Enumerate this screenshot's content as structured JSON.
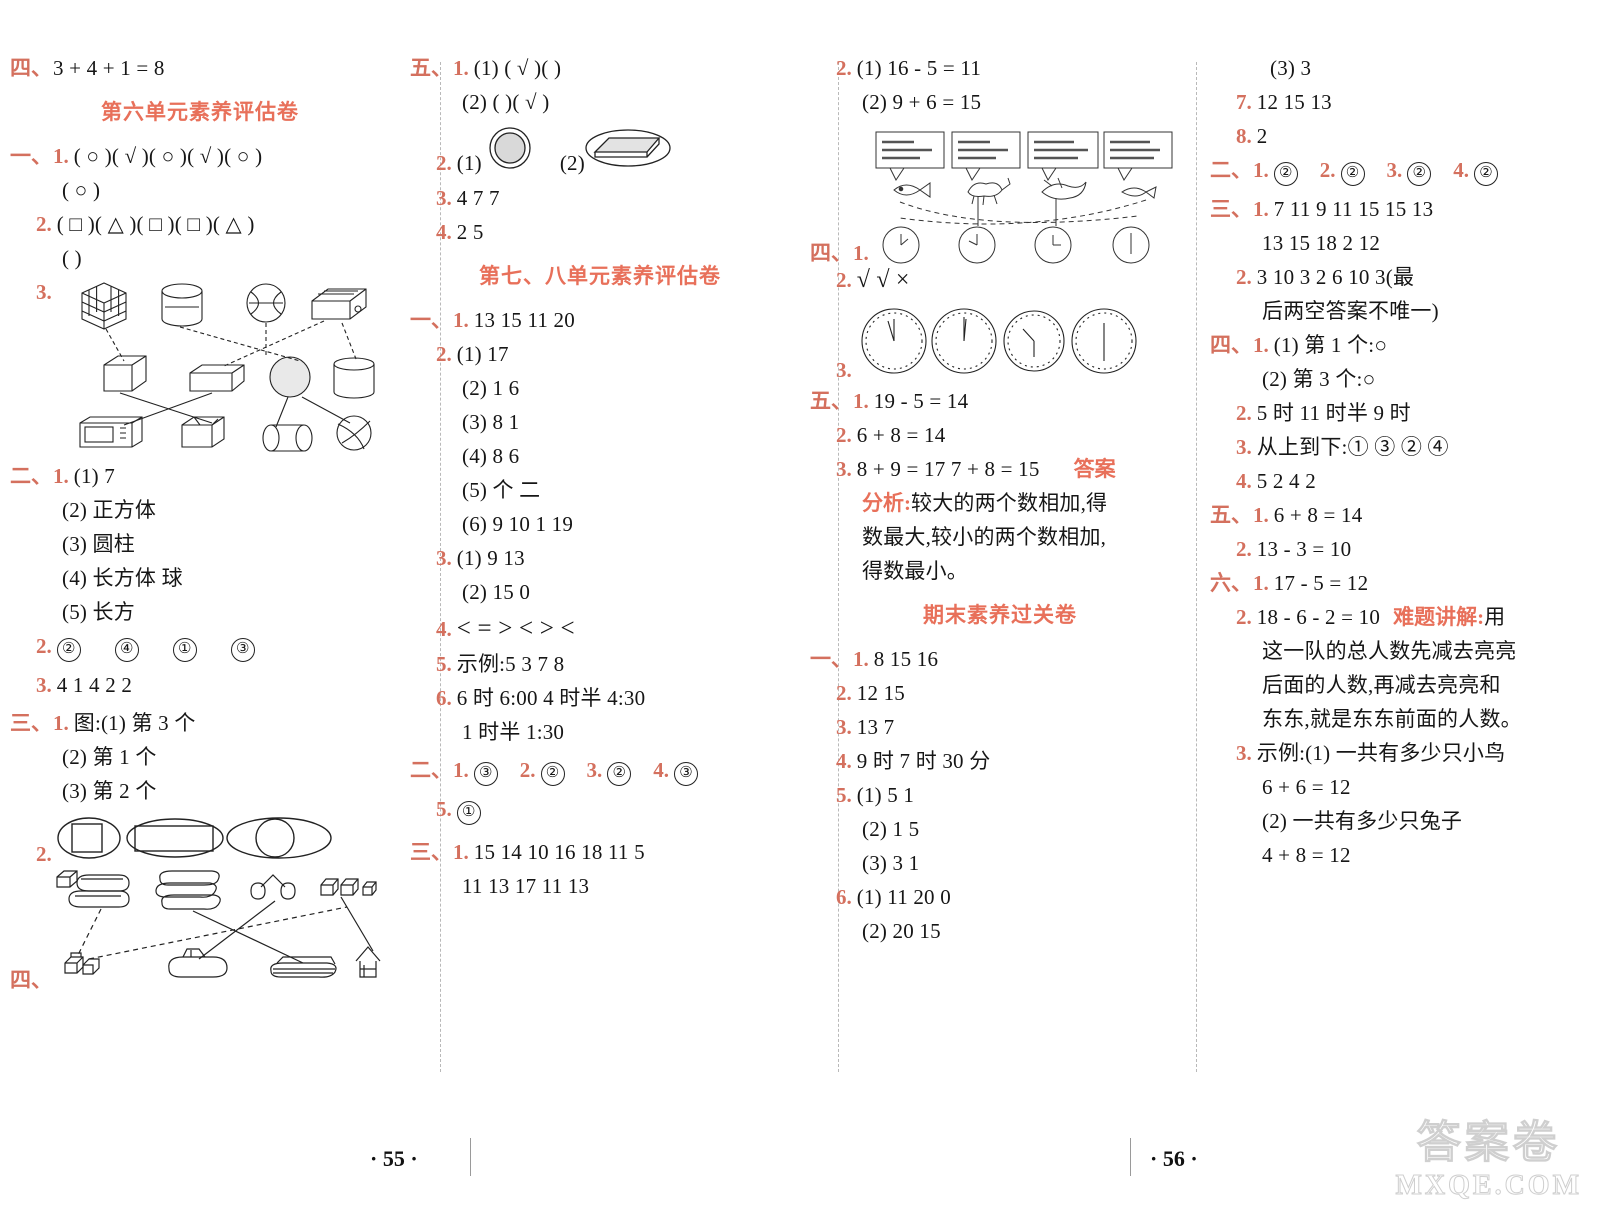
{
  "meta": {
    "page_left": "· 55 ·",
    "page_right": "· 56 ·",
    "watermark_cjk": "答案卷",
    "watermark_domain": "MXQE.COM"
  },
  "col1": {
    "top_row": {
      "sec": "四、",
      "text": "3 + 4 + 1 = 8"
    },
    "title": "第六单元素养评估卷",
    "s1": {
      "sec": "一、",
      "i1": {
        "num": "1.",
        "line1": "( ○ )( √ )( ○ )( √ )( ○ )",
        "line2": "( ○ )"
      },
      "i2": {
        "num": "2.",
        "line1": "( □ )( △ )( □ )( □ )( △ )",
        "line2": "(    )"
      },
      "i3": {
        "num": "3.",
        "caption": "立体图形与实物连线图"
      }
    },
    "s2": {
      "sec": "二、",
      "i1": {
        "num": "1.",
        "lines": [
          "(1) 7",
          "(2) 正方体",
          "(3) 圆柱",
          "(4) 长方体    球",
          "(5) 长方"
        ]
      },
      "i2": {
        "num": "2.",
        "options": [
          "②",
          "④",
          "①",
          "③"
        ]
      },
      "i3": {
        "num": "3.",
        "text": "4    1    4    2    2"
      }
    },
    "s3": {
      "sec": "三、",
      "i1": {
        "num": "1.",
        "lines": [
          "图:(1) 第 3 个",
          "(2) 第 1 个",
          "(3) 第 2 个"
        ]
      },
      "i2": {
        "num": "2.",
        "caption": "圈出图形:正方形、长方形、圆"
      }
    },
    "s4": {
      "sec": "四、",
      "caption": "立体图形拼搭连线图"
    }
  },
  "col2": {
    "s5": {
      "sec": "五、",
      "i1": {
        "num": "1.",
        "line1": "(1) ( √ )(    )",
        "line2": "(2) (    )( √ )"
      },
      "i2": {
        "num": "2.",
        "l1": "(1)",
        "l2": "(2)",
        "caption": "圈出的物体:球、长方体"
      },
      "i3": {
        "num": "3.",
        "text": "4    7    7"
      },
      "i4": {
        "num": "4.",
        "text": "2    5"
      }
    },
    "title": "第七、八单元素养评估卷",
    "s1": {
      "sec": "一、",
      "i1": {
        "num": "1.",
        "text": "13    15    11    20"
      },
      "i2": {
        "num": "2.",
        "lines": [
          "(1) 17",
          "(2) 1    6",
          "(3) 8    1",
          "(4) 8    6",
          "(5) 个    二",
          "(6) 9    10    1    19"
        ]
      },
      "i3": {
        "num": "3.",
        "lines": [
          "(1) 9    13",
          "(2) 15    0"
        ]
      },
      "i4": {
        "num": "4.",
        "text": "<    =    >    <    >    <"
      },
      "i5": {
        "num": "5.",
        "text": "示例:5    3    7    8"
      },
      "i6": {
        "num": "6.",
        "line1": "6 时    6:00    4 时半    4:30",
        "line2": "1 时半    1:30"
      }
    },
    "s2": {
      "sec": "二、",
      "items": [
        "1.",
        "2.",
        "3.",
        "4."
      ],
      "answers": [
        "③",
        "②",
        "②",
        "③"
      ],
      "i5": {
        "num": "5.",
        "answer": "①"
      }
    },
    "s3": {
      "sec": "三、",
      "i1": {
        "num": "1.",
        "line1": "15    14    10    16    18    11    5",
        "line2": "11    13    17    11    13"
      }
    }
  },
  "col3": {
    "s3cont": {
      "i2": {
        "num": "2.",
        "lines": [
          "(1) 16 - 5 = 11",
          "(2) 9 + 6 = 15"
        ]
      }
    },
    "s4": {
      "sec": "四、",
      "i1": {
        "num": "1.",
        "bubbles": [
          "我的尾巴\n要找水呢。",
          "我的尾已\n要起荅媲。",
          "我的尾巴是\n掌握方向的。",
          "我的尾巴已\n经长出来了。"
        ],
        "caption": "动物与钟面连线图"
      },
      "i2": {
        "num": "2.",
        "text": "√    √    ×"
      },
      "i3": {
        "num": "3.",
        "caption": "四个钟面:11时、12时、7时半、6时"
      }
    },
    "s5": {
      "sec": "五、",
      "i1": {
        "num": "1.",
        "text": "19 - 5 = 14"
      },
      "i2": {
        "num": "2.",
        "text": "6 + 8 = 14"
      },
      "i3": {
        "num": "3.",
        "text": "8 + 9 = 17    7 + 8 = 15"
      },
      "badge": "答案",
      "analysis_label": "分析:",
      "analysis_lines": [
        "较大的两个数相加,得",
        "数最大,较小的两个数相加,",
        "得数最小。"
      ]
    },
    "title": "期末素养过关卷",
    "f1": {
      "sec": "一、",
      "i1": {
        "num": "1.",
        "text": "8    15    16"
      },
      "i2": {
        "num": "2.",
        "text": "12    15"
      },
      "i3": {
        "num": "3.",
        "text": "13    7"
      },
      "i4": {
        "num": "4.",
        "text": "9 时    7 时 30 分"
      },
      "i5": {
        "num": "5.",
        "lines": [
          "(1) 5    1",
          "(2) 1    5",
          "(3) 3    1"
        ]
      },
      "i6": {
        "num": "6.",
        "lines": [
          "(1) 11    20    0",
          "(2) 20    15"
        ]
      }
    }
  },
  "col4": {
    "f1cont": {
      "i6line3": "(3) 3",
      "i7": {
        "num": "7.",
        "text": "12    15    13"
      },
      "i8": {
        "num": "8.",
        "text": "2"
      }
    },
    "f2": {
      "sec": "二、",
      "items": [
        "1.",
        "2.",
        "3.",
        "4."
      ],
      "answers": [
        "②",
        "②",
        "②",
        "②"
      ]
    },
    "f3": {
      "sec": "三、",
      "i1": {
        "num": "1.",
        "line1": "7    11    9    11    15    15    13",
        "line2": "13    15    18    2    12"
      },
      "i2": {
        "num": "2.",
        "line1": "3    10    3    2    6    10    3(最",
        "line2": "后两空答案不唯一)"
      }
    },
    "f4": {
      "sec": "四、",
      "i1": {
        "num": "1.",
        "lines": [
          "(1) 第 1 个:○",
          "(2) 第 3 个:○"
        ]
      },
      "i2": {
        "num": "2.",
        "text": "5 时    11 时半    9 时"
      },
      "i3": {
        "num": "3.",
        "text": "从上到下:①    ③    ②    ④"
      },
      "i4": {
        "num": "4.",
        "text": "5    2    4    2"
      }
    },
    "f5": {
      "sec": "五、",
      "i1": {
        "num": "1.",
        "text": "6 + 8 = 14"
      },
      "i2": {
        "num": "2.",
        "text": "13 - 3 = 10"
      }
    },
    "f6": {
      "sec": "六、",
      "i1": {
        "num": "1.",
        "text": "17 - 5 = 12"
      },
      "i2": {
        "num": "2.",
        "text": "18 - 6 - 2 = 10"
      },
      "hard_label": "难题讲解:",
      "hard_lines": [
        "用",
        "这一队的总人数先减去亮亮",
        "后面的人数,再减去亮亮和",
        "东东,就是东东前面的人数。"
      ],
      "i3": {
        "num": "3.",
        "lines": [
          "示例:(1) 一共有多少只小鸟",
          "6 + 6 = 12",
          "(2) 一共有多少只兔子",
          "4 + 8 = 12"
        ]
      }
    }
  },
  "colors": {
    "accent_red": "#d4705e",
    "title_red": "#e8705a",
    "ink": "#161616",
    "watermark": "#cfcfcf"
  }
}
